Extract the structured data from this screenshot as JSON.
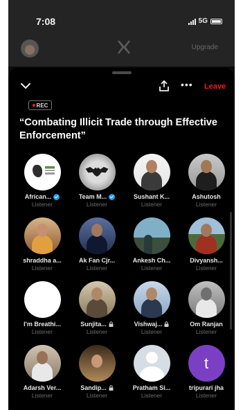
{
  "status_bar": {
    "time": "7:08",
    "network": "5G"
  },
  "app_bar": {
    "upgrade_label": "Upgrade"
  },
  "space": {
    "leave_label": "Leave",
    "rec_label": "REC",
    "title": "“Combating Illicit Trade through Effective Enforcement”"
  },
  "participants": [
    {
      "name": "African...",
      "role": "Listener",
      "badge": "verified"
    },
    {
      "name": "Team M...",
      "role": "Listener",
      "badge": "verified"
    },
    {
      "name": "Sushant K...",
      "role": "Listener",
      "badge": ""
    },
    {
      "name": "Ashutosh",
      "role": "Listener",
      "badge": ""
    },
    {
      "name": "shraddha a...",
      "role": "Listener",
      "badge": ""
    },
    {
      "name": "Ak Fan Cjr...",
      "role": "Listener",
      "badge": ""
    },
    {
      "name": "Ankesh Ch...",
      "role": "Listener",
      "badge": ""
    },
    {
      "name": "Divyansh...",
      "role": "Listener",
      "badge": ""
    },
    {
      "name": "I'm Breathi...",
      "role": "Listener",
      "badge": ""
    },
    {
      "name": "Sunjita...",
      "role": "Listener",
      "badge": "lock"
    },
    {
      "name": "Vishwaj...",
      "role": "Listener",
      "badge": "lock"
    },
    {
      "name": "Om Ranjan",
      "role": "Listener",
      "badge": ""
    },
    {
      "name": "Adarsh Ver...",
      "role": "Listener",
      "badge": ""
    },
    {
      "name": "Sandip...",
      "role": "Listener",
      "badge": "lock"
    },
    {
      "name": "Pratham Si...",
      "role": "Listener",
      "badge": ""
    },
    {
      "name": "tripurari jha",
      "role": "Listener",
      "badge": "",
      "avatar_letter": "t"
    }
  ],
  "colors": {
    "leave": "#e81c2a",
    "verified": "#1d9bf0",
    "tripurari_avatar": "#7b3fc4"
  },
  "icons": [
    "flame-avatar-icon",
    "x-logo-icon",
    "chevron-down-icon",
    "share-icon",
    "more-icon",
    "verified-badge-icon",
    "lock-icon",
    "rec-dot-icon"
  ]
}
